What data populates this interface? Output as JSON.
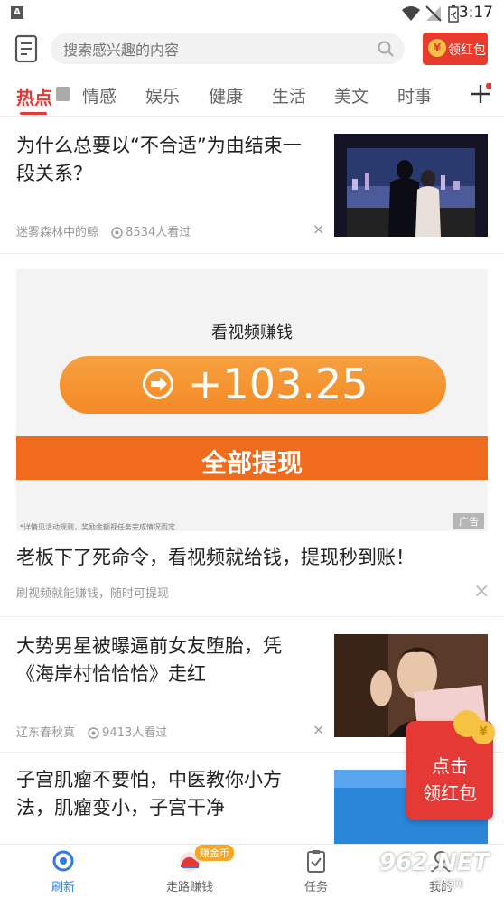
{
  "status_bar": {
    "time": "3:17",
    "sim_label": "A"
  },
  "header": {
    "search_placeholder": "搜索感兴趣的内容",
    "redpack_label": "领红包",
    "redpack_coin": "¥"
  },
  "tabs": [
    {
      "label": "热点"
    },
    {
      "label": "情感"
    },
    {
      "label": "娱乐"
    },
    {
      "label": "健康"
    },
    {
      "label": "生活"
    },
    {
      "label": "美文"
    },
    {
      "label": "时事"
    }
  ],
  "feed": {
    "item1": {
      "title_line1": "为什么总要以“不合适”为由结束一",
      "title_line2": "段关系？",
      "source": "迷雾森林中的鲸",
      "views": "8534人看过",
      "close": "×"
    },
    "ad": {
      "heading": "看视频赚钱",
      "amount": "+103.25",
      "button": "全部提现",
      "fine_print": "*详情见活动规则，奖励金额视任务完成情况而定",
      "tag": "广告",
      "title": "老板下了死命令，看视频就给钱，提现秒到账！",
      "subtitle": "刷视频就能赚钱，随时可提现",
      "close": "×"
    },
    "item2": {
      "title_line1": "大势男星被曝逼前女友堕胎，凭",
      "title_line2": "《海岸村恰恰恰》走红",
      "source": "辽东春秋真",
      "views": "9413人看过",
      "close": "×"
    },
    "item3": {
      "title_line1": "子宫肌瘤不要怕，中医教你小方",
      "title_line2": "法，肌瘤变小，子宫干净"
    }
  },
  "float_redpack": {
    "line1": "点击",
    "line2": "领红包",
    "coin": "¥"
  },
  "bottom_nav": [
    {
      "label": "刷新"
    },
    {
      "label": "走路赚钱",
      "badge": "赚金币"
    },
    {
      "label": "任务"
    },
    {
      "label": "我的"
    }
  ],
  "watermark": {
    "logo": "962.NET",
    "sub": "乐游网"
  },
  "colors": {
    "accent": "#e53935",
    "nav_active": "#2f7be0",
    "ad_orange": "#f38a25"
  }
}
